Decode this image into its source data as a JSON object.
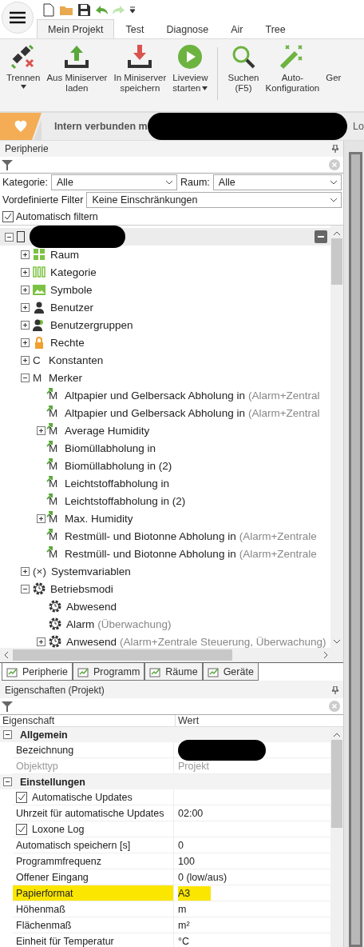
{
  "quick_access": {
    "items": [
      {
        "kind": "new"
      },
      {
        "kind": "open"
      },
      {
        "kind": "save"
      },
      {
        "kind": "undo",
        "disabled": false
      },
      {
        "kind": "redo",
        "disabled": true
      }
    ]
  },
  "ribbon_tabs": [
    {
      "label": "Mein Projekt",
      "selected": true
    },
    {
      "label": "Test",
      "selected": false
    },
    {
      "label": "Diagnose",
      "selected": false
    },
    {
      "label": "Air",
      "selected": false
    },
    {
      "label": "Tree",
      "selected": false
    }
  ],
  "ribbon": [
    {
      "kind": "disconnect",
      "label": "Trennen",
      "dropdown": true
    },
    {
      "kind": "upload",
      "label": "Aus Miniserver\nladen",
      "dropdown": false
    },
    {
      "kind": "download",
      "label": "In Miniserver\nspeichern",
      "dropdown": false
    },
    {
      "kind": "play",
      "label": "Liveview\nstarten",
      "dropdown": true
    },
    {
      "kind": "separator"
    },
    {
      "kind": "search",
      "label": "Suchen\n(F5)",
      "dropdown": false
    },
    {
      "kind": "wand",
      "label": "Auto-\nKonfiguration",
      "dropdown": false
    },
    {
      "kind": "cut",
      "label": "Ger"
    }
  ],
  "status_bar": {
    "text": "Intern verbunden m",
    "right_text": "Lo"
  },
  "peripherie": {
    "title": "Peripherie",
    "filters": {
      "category_label": "Kategorie:",
      "category_value": "Alle",
      "room_label": "Raum:",
      "room_value": "Alle",
      "predefined_label": "Vordefinierte Filter",
      "predefined_value": "Keine Einschränkungen",
      "auto_filter": {
        "label": "Automatisch filtern",
        "checked": true
      }
    },
    "tree": {
      "root": {
        "kind": "project",
        "expanded": true,
        "selected": true,
        "children": [
          {
            "kind": "grid",
            "label": "Raum",
            "expanded": false
          },
          {
            "kind": "bars",
            "label": "Kategorie",
            "expanded": false
          },
          {
            "kind": "image",
            "label": "Symbole",
            "expanded": false
          },
          {
            "kind": "user",
            "label": "Benutzer",
            "expanded": false
          },
          {
            "kind": "users",
            "label": "Benutzergruppen",
            "expanded": false
          },
          {
            "kind": "lock",
            "label": "Rechte",
            "expanded": false
          },
          {
            "glyph": "C",
            "label": "Konstanten",
            "expanded": false
          },
          {
            "glyph": "M",
            "label": "Merker",
            "expanded": true,
            "children": [
              {
                "glyph": "M",
                "arrow": true,
                "label": "Altpapier und Gelbersack Abholung in",
                "note": "(Alarm+Zentral"
              },
              {
                "glyph": "M",
                "arrow": true,
                "label": "Altpapier und Gelbersack Abholung in",
                "note": "(Alarm+Zentral"
              },
              {
                "glyph": "M",
                "arrow": true,
                "label": "Average Humidity",
                "expanded": false
              },
              {
                "glyph": "M",
                "arrow": true,
                "label": "Biomüllabholung in"
              },
              {
                "glyph": "M",
                "arrow": true,
                "label": "Biomüllabholung in (2)"
              },
              {
                "glyph": "M",
                "arrow": true,
                "label": "Leichtstoffabholung in"
              },
              {
                "glyph": "M",
                "arrow": true,
                "label": "Leichtstoffabholung in (2)"
              },
              {
                "glyph": "M",
                "arrow": true,
                "label": "Max. Humidity",
                "expanded": false
              },
              {
                "glyph": "M",
                "arrow": true,
                "label": "Restmüll- und Biotonne Abholung in",
                "note": "(Alarm+Zentrale"
              },
              {
                "glyph": "M",
                "arrow": true,
                "label": "Restmüll- und Biotonne Abholung in",
                "note": "(Alarm+Zentrale"
              }
            ]
          },
          {
            "glyph": "(×)",
            "label": "Systemvariablen",
            "expanded": false
          },
          {
            "kind": "gear",
            "label": "Betriebsmodi",
            "expanded": true,
            "children": [
              {
                "kind": "gear",
                "label": "Abwesend"
              },
              {
                "kind": "gear",
                "label": "Alarm",
                "note": "(Überwachung)"
              },
              {
                "kind": "gear",
                "label": "Anwesend",
                "note": "(Alarm+Zentrale Steuerung, Überwachung)",
                "expanded": false
              }
            ]
          }
        ]
      }
    },
    "tabs": [
      {
        "label": "Peripherie",
        "selected": true
      },
      {
        "label": "Programm",
        "selected": false
      },
      {
        "label": "Räume",
        "selected": false
      },
      {
        "label": "Geräte",
        "selected": false
      }
    ]
  },
  "properties": {
    "title": "Eigenschaften (Projekt)",
    "columns": [
      "Eigenschaft",
      "Wert"
    ],
    "groups": [
      {
        "name": "Allgemein",
        "expanded": true,
        "rows": [
          {
            "kind": "plain",
            "name": "Bezeichnung",
            "highlighted": false
          },
          {
            "kind": "readonly",
            "name": "Objekttyp",
            "value": "Projekt",
            "highlighted": false
          }
        ]
      },
      {
        "name": "Einstellungen",
        "expanded": true,
        "rows": [
          {
            "kind": "check",
            "name": "Automatische Updates",
            "checked": true,
            "highlighted": false
          },
          {
            "kind": "plain",
            "name": "Uhrzeit für automatische Updates",
            "value": "02:00",
            "highlighted": false
          },
          {
            "kind": "check",
            "name": "Loxone Log",
            "checked": true,
            "highlighted": false
          },
          {
            "kind": "plain",
            "name": "Automatisch speichern [s]",
            "value": "0",
            "highlighted": false
          },
          {
            "kind": "plain",
            "name": "Programmfrequenz",
            "value": "100",
            "highlighted": false
          },
          {
            "kind": "plain",
            "name": "Offener Eingang",
            "value": "0 (low/aus)",
            "highlighted": false
          },
          {
            "kind": "plain",
            "name": "Papierformat",
            "value": "A3",
            "highlighted": true
          },
          {
            "kind": "plain",
            "name": "Höhenmaß",
            "value": "m",
            "highlighted": false
          },
          {
            "kind": "plain",
            "name": "Flächenmaß",
            "value": "m²",
            "highlighted": false
          },
          {
            "kind": "plain",
            "name": "Einheit für Temperatur",
            "value": "°C",
            "highlighted": false
          }
        ]
      }
    ]
  }
}
